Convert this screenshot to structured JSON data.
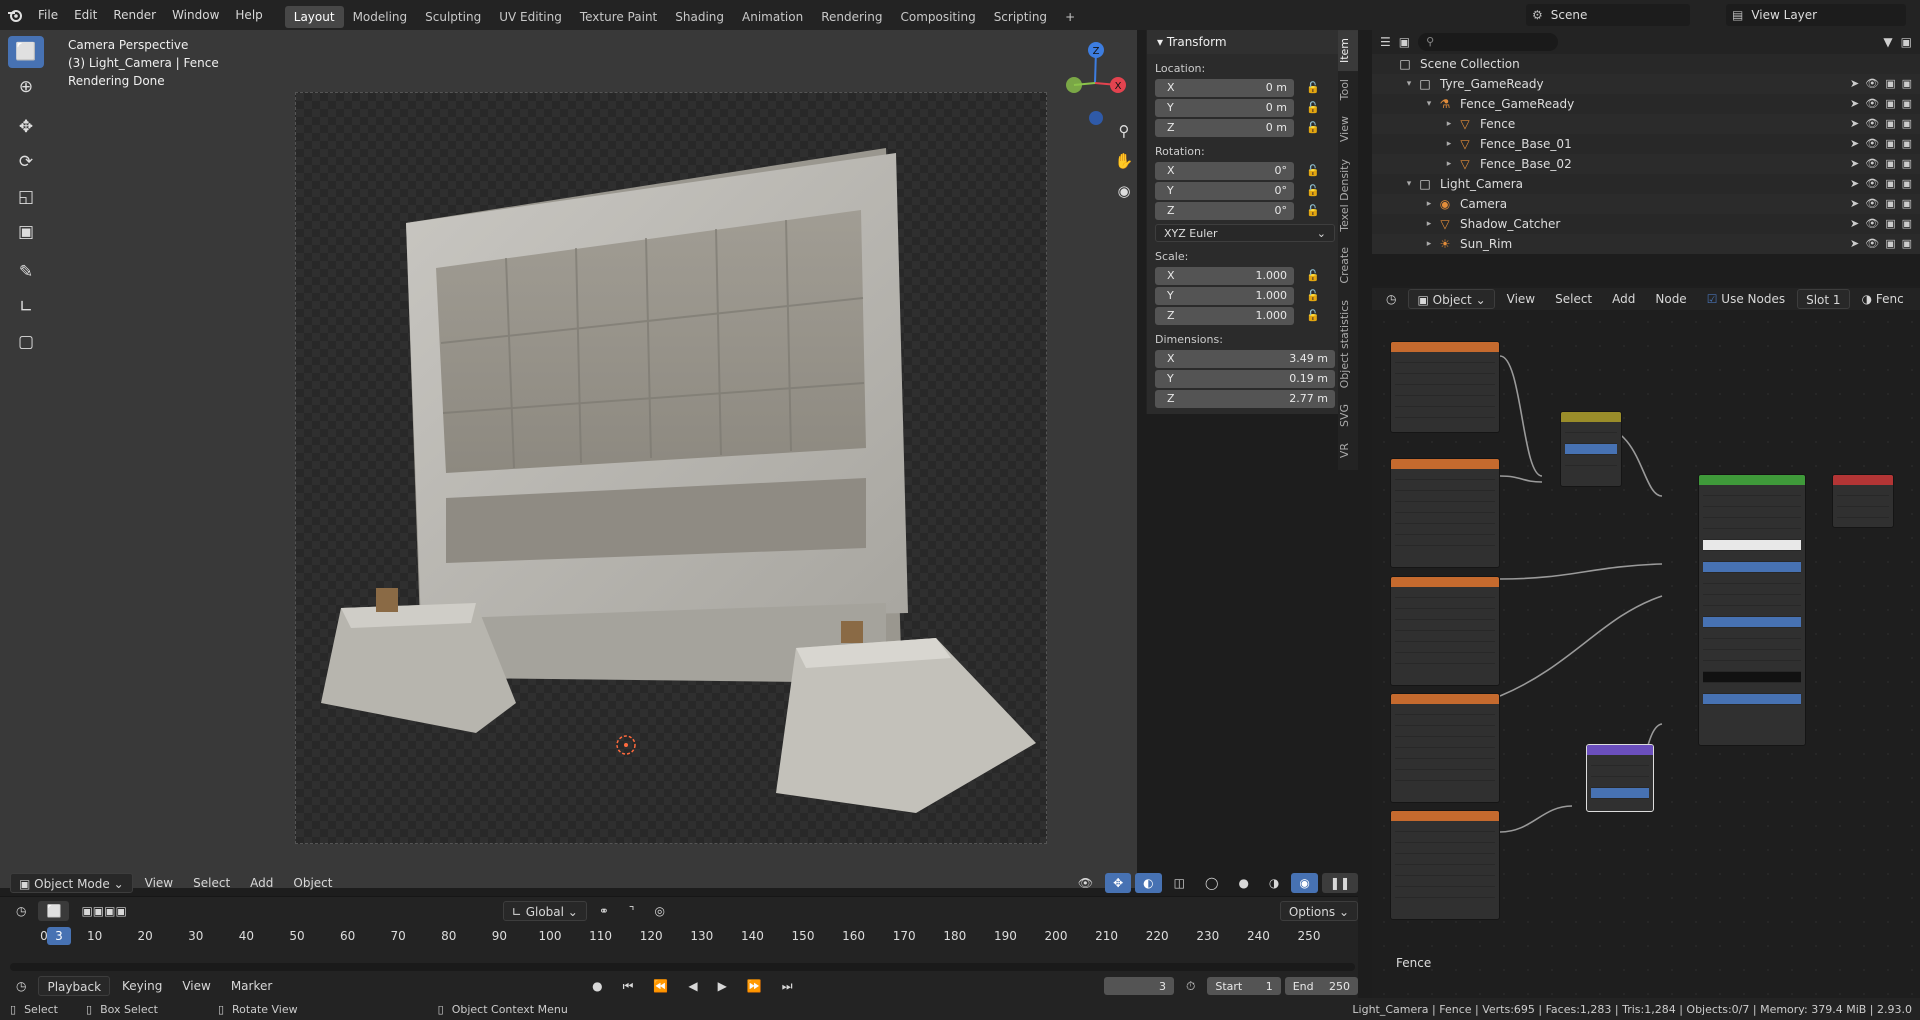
{
  "topbar": {
    "menus": [
      "File",
      "Edit",
      "Render",
      "Window",
      "Help"
    ],
    "workspaces": [
      "Layout",
      "Modeling",
      "Sculpting",
      "UV Editing",
      "Texture Paint",
      "Shading",
      "Animation",
      "Rendering",
      "Compositing",
      "Scripting"
    ],
    "active_workspace": "Layout",
    "add_tab": "+",
    "scene": "Scene",
    "view_layer": "View Layer"
  },
  "viewport": {
    "info_line1": "Camera Perspective",
    "info_line2": "(3) Light_Camera | Fence",
    "info_line3": "Rendering Done",
    "tools": [
      "select-box-icon",
      "cursor-icon",
      "move-icon",
      "rotate-icon",
      "scale-icon",
      "transform-icon",
      "annotate-icon",
      "measure-icon",
      "add-cube-icon"
    ],
    "gizmo": {
      "x": "X",
      "y": "Y",
      "z": "Z"
    }
  },
  "npanel": {
    "title": "Transform",
    "location_label": "Location:",
    "location": [
      {
        "axis": "X",
        "value": "0 m"
      },
      {
        "axis": "Y",
        "value": "0 m"
      },
      {
        "axis": "Z",
        "value": "0 m"
      }
    ],
    "rotation_label": "Rotation:",
    "rotation": [
      {
        "axis": "X",
        "value": "0°"
      },
      {
        "axis": "Y",
        "value": "0°"
      },
      {
        "axis": "Z",
        "value": "0°"
      }
    ],
    "rotation_mode": "XYZ Euler",
    "scale_label": "Scale:",
    "scale": [
      {
        "axis": "X",
        "value": "1.000"
      },
      {
        "axis": "Y",
        "value": "1.000"
      },
      {
        "axis": "Z",
        "value": "1.000"
      }
    ],
    "dimensions_label": "Dimensions:",
    "dimensions": [
      {
        "axis": "X",
        "value": "3.49 m"
      },
      {
        "axis": "Y",
        "value": "0.19 m"
      },
      {
        "axis": "Z",
        "value": "2.77 m"
      }
    ],
    "tabs": [
      "Item",
      "Tool",
      "View",
      "Texel Density",
      "Create",
      "Object statistics",
      "SVG",
      "VR"
    ]
  },
  "viewport_header": {
    "mode": "Object Mode",
    "menus": [
      "View",
      "Select",
      "Add",
      "Object"
    ],
    "orientation": "Global",
    "options": "Options"
  },
  "timeline": {
    "menus": [
      "Playback",
      "Keying",
      "View",
      "Marker"
    ],
    "ticks": [
      "0",
      "10",
      "20",
      "30",
      "40",
      "50",
      "60",
      "70",
      "80",
      "90",
      "100",
      "110",
      "120",
      "130",
      "140",
      "150",
      "160",
      "170",
      "180",
      "190",
      "200",
      "210",
      "220",
      "230",
      "240",
      "250"
    ],
    "current_frame": "3",
    "frame_field": "3",
    "start_label": "Start",
    "start": "1",
    "end_label": "End",
    "end": "250"
  },
  "outliner": {
    "items": [
      {
        "name": "Scene Collection",
        "depth": 0,
        "icon": "collection-icon"
      },
      {
        "name": "Tyre_GameReady",
        "depth": 1,
        "icon": "collection-icon"
      },
      {
        "name": "Fence_GameReady",
        "depth": 2,
        "icon": "armature-icon"
      },
      {
        "name": "Fence",
        "depth": 3,
        "icon": "mesh-icon"
      },
      {
        "name": "Fence_Base_01",
        "depth": 3,
        "icon": "mesh-icon"
      },
      {
        "name": "Fence_Base_02",
        "depth": 3,
        "icon": "mesh-icon"
      },
      {
        "name": "Light_Camera",
        "depth": 1,
        "icon": "collection-icon"
      },
      {
        "name": "Camera",
        "depth": 2,
        "icon": "camera-icon"
      },
      {
        "name": "Shadow_Catcher",
        "depth": 2,
        "icon": "mesh-icon"
      },
      {
        "name": "Sun_Rim",
        "depth": 2,
        "icon": "light-icon"
      }
    ]
  },
  "node_editor": {
    "type": "Object",
    "menus": [
      "View",
      "Select",
      "Add",
      "Node"
    ],
    "use_nodes": "Use Nodes",
    "slot": "Slot 1",
    "material": "Fenc",
    "footer_label": "Fence"
  },
  "statusbar": {
    "select": "Select",
    "box_select": "Box Select",
    "rotate_view": "Rotate View",
    "context_menu": "Object Context Menu",
    "stats": "Light_Camera | Fence | Verts:695 | Faces:1,283 | Tris:1,284 | Objects:0/7 | Memory: 379.4 MiB | 2.93.0"
  },
  "colors": {
    "accent": "#4772b3",
    "x_axis": "#e3434f",
    "y_axis": "#8bc34a",
    "z_axis": "#3d7de0"
  }
}
